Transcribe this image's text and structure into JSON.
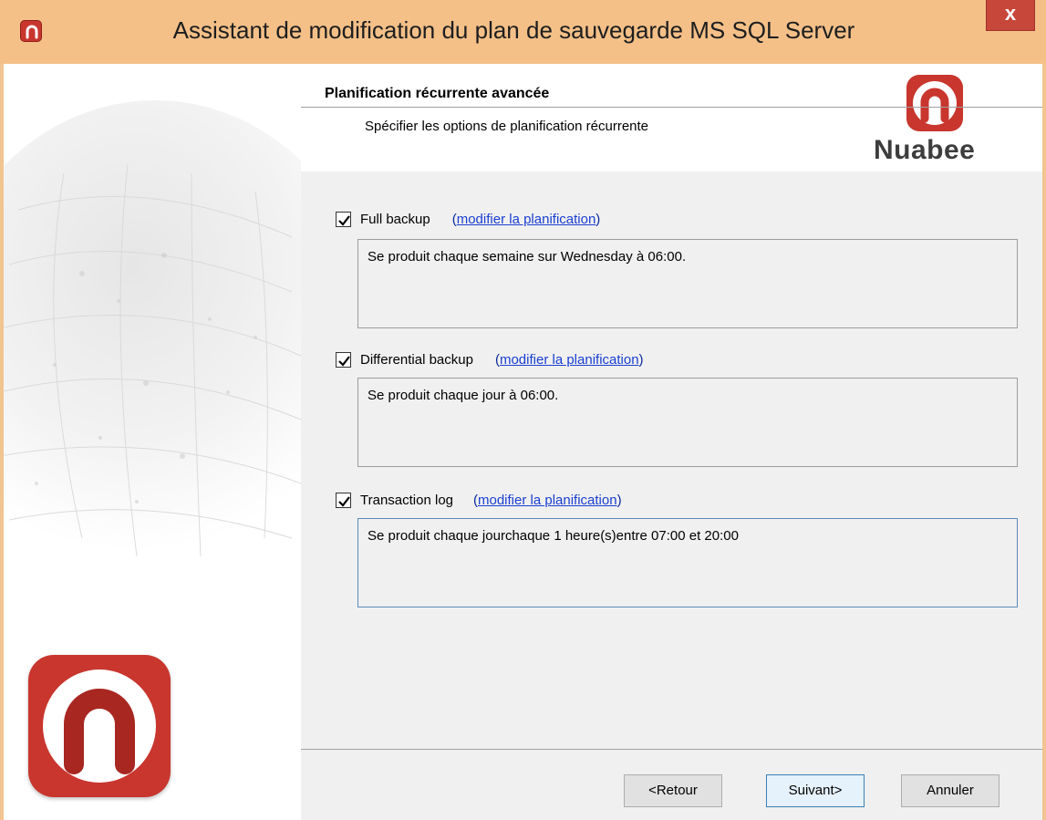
{
  "window": {
    "title": "Assistant de modification du plan de sauvegarde MS SQL Server",
    "close_label": "x",
    "accent_color": "#c8362e",
    "titlebar_color": "#f4c088"
  },
  "header": {
    "title": "Planification récurrente avancée",
    "subtitle": "Spécifier les options de planification récurrente",
    "brand_name": "Nuabee"
  },
  "sections": [
    {
      "checked": true,
      "label": "Full backup",
      "link_open": "(",
      "link_text": "modifier la planification",
      "link_close": ")",
      "description": "Se produit chaque semaine sur Wednesday à 06:00."
    },
    {
      "checked": true,
      "label": "Differential backup",
      "link_open": "(",
      "link_text": "modifier la planification",
      "link_close": ")",
      "description": "Se produit chaque jour à 06:00."
    },
    {
      "checked": true,
      "label": "Transaction log",
      "link_open": "(",
      "link_text": "modifier la planification",
      "link_close": ")",
      "description": "Se produit chaque jourchaque 1 heure(s)entre 07:00 et 20:00"
    }
  ],
  "footer": {
    "back_label": "<Retour",
    "next_label": "Suivant>",
    "cancel_label": "Annuler"
  }
}
